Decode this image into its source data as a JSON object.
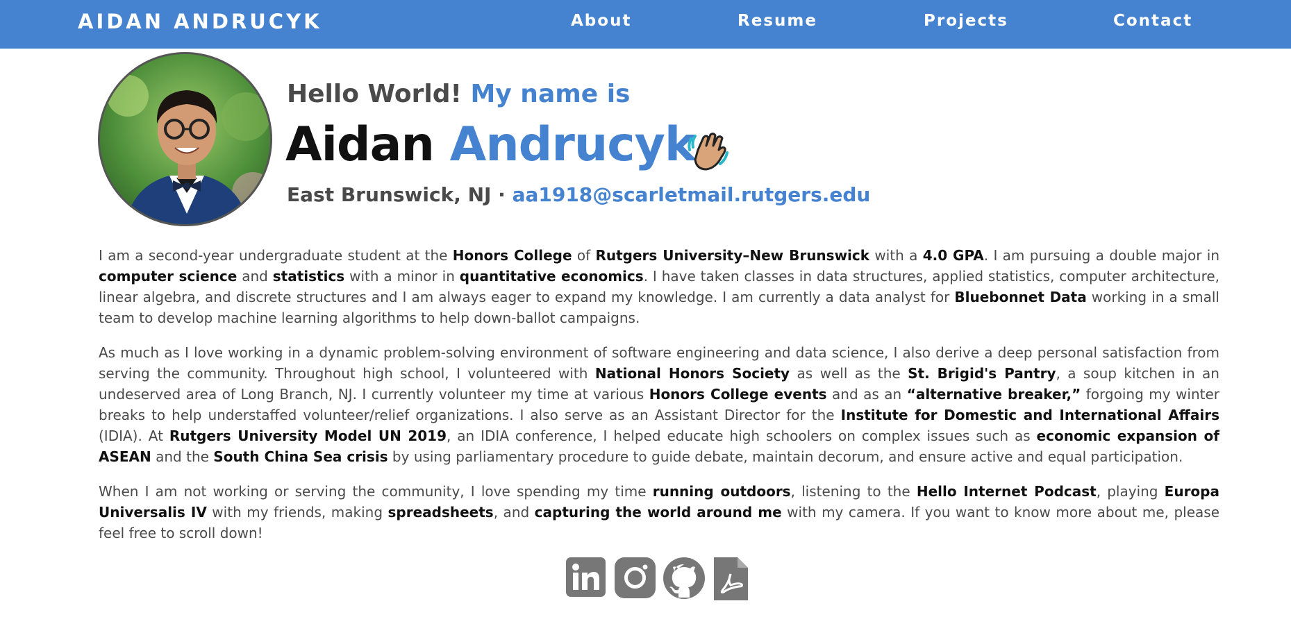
{
  "nav": {
    "brand": "AIDAN ANDRUCYK",
    "links": [
      "About",
      "Resume",
      "Projects",
      "Contact"
    ]
  },
  "header": {
    "hello_prefix": "Hello World!",
    "hello_suffix": "My name is",
    "first_name": "Aidan",
    "last_name": "Andrucyk",
    "location": "East Brunswick, NJ ·",
    "email": "aa1918@scarletmail.rutgers.edu"
  },
  "bio": {
    "p1": [
      {
        "t": "I am a second-year undergraduate student at the "
      },
      {
        "t": "Honors College",
        "b": true
      },
      {
        "t": " of "
      },
      {
        "t": "Rutgers University–New Brunswick",
        "b": true
      },
      {
        "t": " with a "
      },
      {
        "t": "4.0 GPA",
        "b": true
      },
      {
        "t": ". I am pursuing a double major in "
      },
      {
        "t": "computer science",
        "b": true
      },
      {
        "t": " and "
      },
      {
        "t": "statistics",
        "b": true
      },
      {
        "t": " with a minor in "
      },
      {
        "t": "quantitative economics",
        "b": true
      },
      {
        "t": ". I have taken classes in data structures, applied statistics, computer architecture, linear algebra, and discrete structures and I am always eager to expand my knowledge. I am currently a data analyst for "
      },
      {
        "t": "Bluebonnet Data",
        "b": true
      },
      {
        "t": " working in a small team to develop machine learning algorithms to help down-ballot campaigns."
      }
    ],
    "p2": [
      {
        "t": "As much as I love working in a dynamic problem-solving environment of software engineering and data science, I also derive a deep personal satisfaction from serving the community. Throughout high school, I volunteered with "
      },
      {
        "t": "National Honors Society",
        "b": true
      },
      {
        "t": " as well as the "
      },
      {
        "t": "St. Brigid's Pantry",
        "b": true
      },
      {
        "t": ", a soup kitchen in an undeserved area of Long Branch, NJ. I currently volunteer my time at various "
      },
      {
        "t": "Honors College events",
        "b": true
      },
      {
        "t": " and as an "
      },
      {
        "t": "“alternative breaker,”",
        "b": true
      },
      {
        "t": " forgoing my winter breaks to help understaffed volunteer/relief organizations. I also serve as an Assistant Director for the "
      },
      {
        "t": "Institute for Domestic and International Affairs",
        "b": true
      },
      {
        "t": " (IDIA). At "
      },
      {
        "t": "Rutgers University Model UN 2019",
        "b": true
      },
      {
        "t": ", an IDIA conference, I helped educate high schoolers on complex issues such as "
      },
      {
        "t": "economic expansion of ASEAN",
        "b": true
      },
      {
        "t": " and the "
      },
      {
        "t": "South China Sea crisis",
        "b": true
      },
      {
        "t": " by using parliamentary procedure to guide debate, maintain decorum, and ensure active and equal participation."
      }
    ],
    "p3": [
      {
        "t": "When I am not working or serving the community, I love spending my time "
      },
      {
        "t": "running outdoors",
        "b": true
      },
      {
        "t": ", listening to the "
      },
      {
        "t": "Hello Internet Podcast",
        "b": true
      },
      {
        "t": ", playing "
      },
      {
        "t": "Europa Universalis IV",
        "b": true
      },
      {
        "t": " with my friends, making "
      },
      {
        "t": "spreadsheets",
        "b": true
      },
      {
        "t": ", and "
      },
      {
        "t": "capturing the world around me",
        "b": true
      },
      {
        "t": " with my camera. If you want to know more about me, please feel free to scroll down!"
      }
    ]
  },
  "social": {
    "icons": [
      "linkedin-icon",
      "instagram-icon",
      "github-icon",
      "pdf-resume-icon"
    ]
  },
  "colors": {
    "accent": "#4583d1",
    "text": "#4a4a4a",
    "strong": "#111111",
    "icon_gray": "#777777"
  }
}
